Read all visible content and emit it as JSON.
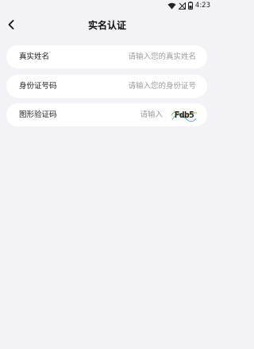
{
  "status_bar": {
    "time": "4:23",
    "icons": [
      "wifi-icon",
      "no-signal-icon",
      "battery-icon"
    ]
  },
  "header": {
    "title": "实名认证",
    "back_icon": "chevron-left-icon"
  },
  "form": {
    "real_name": {
      "label": "真实姓名",
      "placeholder": "请输入您的真实姓名",
      "value": ""
    },
    "id_number": {
      "label": "身份证号码",
      "placeholder": "请输入您的身份证号",
      "value": ""
    },
    "captcha": {
      "label": "图形验证码",
      "placeholder": "请输入",
      "value": "",
      "image_text": "Fdb5"
    }
  },
  "colors": {
    "background": "#f2f2f7",
    "card": "#ffffff",
    "placeholder": "#9a9a9a"
  }
}
